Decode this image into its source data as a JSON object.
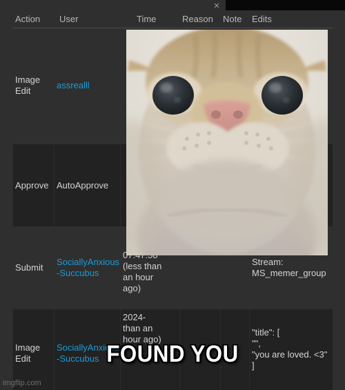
{
  "window": {
    "close_icon": "close-icon",
    "close_label": "×"
  },
  "table": {
    "columns": [
      "Action",
      "User",
      "Time",
      "Reason",
      "Note",
      "Edits"
    ],
    "rows": [
      {
        "action": "Image Edit",
        "user": "assrealll",
        "time": "",
        "reason": "",
        "note": "",
        "edits": ""
      },
      {
        "action": "Approve",
        "user": "AutoApprove",
        "time": "",
        "reason": "",
        "note": "",
        "edits": ""
      },
      {
        "action": "Submit",
        "user": "SociallyAnxious-Succubus",
        "time": "07:47:58 (less than an hour ago)",
        "reason": "",
        "note": "",
        "edits": "Stream: MS_memer_group"
      },
      {
        "action": "Image Edit",
        "user": "SociallyAnxious-Succubus",
        "time": "2024- than an hour ago)",
        "reason": "",
        "note": "",
        "edits": "\"title\": [\n\"\",\n\"you are loved. <3\"\n]"
      }
    ]
  },
  "meme": {
    "caption": "FOUND YOU",
    "image_alt": "close-up-cat-face"
  },
  "watermark": {
    "text": "imgflip.com"
  },
  "colors": {
    "background": "#2f2f2f",
    "row_alt": "#222222",
    "text": "#d4d4d4",
    "header_text": "#b8b8b8",
    "link": "#1b9cd8",
    "caption": "#ffffff",
    "top_bar": "#080808"
  }
}
